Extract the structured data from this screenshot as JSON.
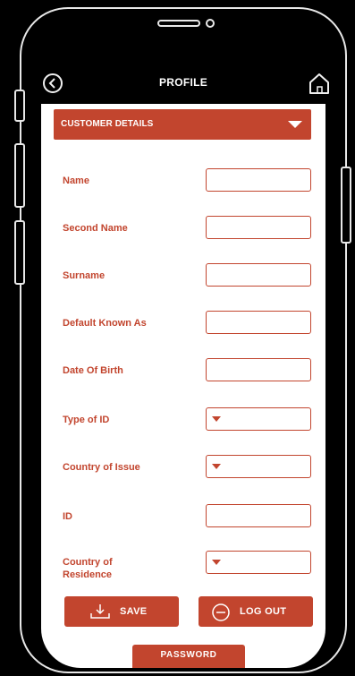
{
  "header": {
    "title": "PROFILE"
  },
  "section": {
    "label": "CUSTOMER DETAILS"
  },
  "fields": [
    {
      "label": "Name",
      "type": "text",
      "value": ""
    },
    {
      "label": "Second Name",
      "type": "text",
      "value": ""
    },
    {
      "label": "Surname",
      "type": "text",
      "value": ""
    },
    {
      "label": "Default Known As",
      "type": "text",
      "value": ""
    },
    {
      "label": "Date Of Birth",
      "type": "text",
      "value": ""
    },
    {
      "label": "Type of ID",
      "type": "select",
      "value": ""
    },
    {
      "label": "Country of Issue",
      "type": "select",
      "value": ""
    },
    {
      "label": "ID",
      "type": "text",
      "value": ""
    },
    {
      "label": "Country of\nResidence",
      "type": "select",
      "value": ""
    }
  ],
  "buttons": {
    "save": "SAVE",
    "logout": "LOG OUT",
    "password": "PASSWORD"
  },
  "colors": {
    "accent": "#c2452e",
    "background": "#000000",
    "screen": "#ffffff"
  },
  "icons": {
    "back": "back-arrow-circle-icon",
    "home": "home-icon",
    "save": "download-icon",
    "logout": "minus-circle-icon",
    "section": "caret-down-icon"
  }
}
